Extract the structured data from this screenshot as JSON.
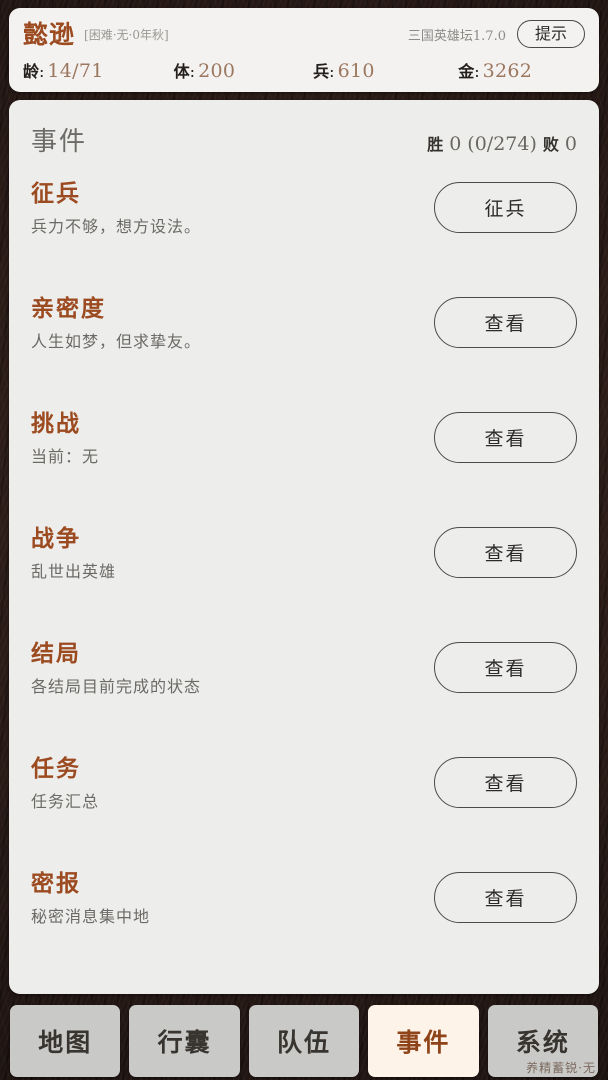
{
  "header": {
    "hero_name": "懿逊",
    "hero_meta": "[困难·无·0年秋]",
    "version": "三国英雄坛1.7.0",
    "hint_button": "提示",
    "stats": [
      {
        "label": "龄",
        "colon": ":",
        "value": "14/71"
      },
      {
        "label": "体",
        "colon": ":",
        "value": "200"
      },
      {
        "label": "兵",
        "colon": ":",
        "value": "610"
      },
      {
        "label": "金",
        "colon": ":",
        "value": "3262"
      }
    ]
  },
  "panel": {
    "title": "事件",
    "win_label": "胜",
    "win_value": "0",
    "progress": "(0/274)",
    "loss_label": "败",
    "loss_value": "0",
    "events": [
      {
        "title": "征兵",
        "desc": "兵力不够，想方设法。",
        "action": "征兵"
      },
      {
        "title": "亲密度",
        "desc": "人生如梦，但求挚友。",
        "action": "查看"
      },
      {
        "title": "挑战",
        "desc": "当前：无",
        "action": "查看"
      },
      {
        "title": "战争",
        "desc": "乱世出英雄",
        "action": "查看"
      },
      {
        "title": "结局",
        "desc": "各结局目前完成的状态",
        "action": "查看"
      },
      {
        "title": "任务",
        "desc": "任务汇总",
        "action": "查看"
      },
      {
        "title": "密报",
        "desc": "秘密消息集中地",
        "action": "查看"
      }
    ]
  },
  "tabbar": {
    "tabs": [
      {
        "label": "地图",
        "active": false
      },
      {
        "label": "行囊",
        "active": false
      },
      {
        "label": "队伍",
        "active": false
      },
      {
        "label": "事件",
        "active": true
      },
      {
        "label": "系统",
        "active": false
      }
    ]
  },
  "footer": {
    "status": "养精蓄锐·无"
  },
  "colors": {
    "accent_brown": "#9c4a20",
    "panel_bg": "#ededeb",
    "header_bg": "#f3f2f0",
    "tab_bg": "#c9c9c7",
    "tab_active_bg": "#fdf3e8",
    "value_brown": "#9c7760"
  }
}
